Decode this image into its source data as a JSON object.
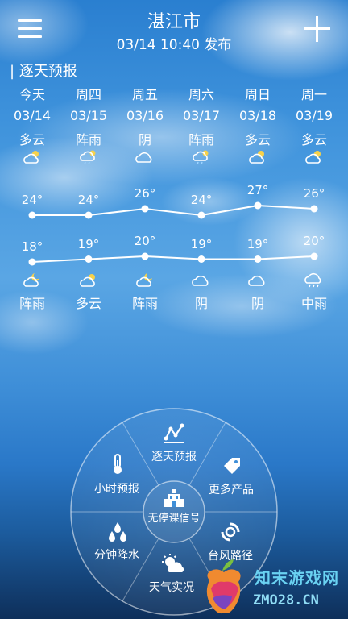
{
  "header": {
    "city": "湛江市",
    "publish_time": "03/14 10:40 发布"
  },
  "section_title": "| 逐天预报",
  "days": [
    {
      "weekday": "今天",
      "date": "03/14",
      "day_weather": "多云",
      "day_icon": "partly-cloudy-icon",
      "high": "24°",
      "low": "18°",
      "night_icon": "partly-cloudy-night-icon",
      "night_weather": "阵雨"
    },
    {
      "weekday": "周四",
      "date": "03/15",
      "day_weather": "阵雨",
      "day_icon": "shower-icon",
      "high": "24°",
      "low": "19°",
      "night_icon": "partly-cloudy-icon",
      "night_weather": "多云"
    },
    {
      "weekday": "周五",
      "date": "03/16",
      "day_weather": "阴",
      "day_icon": "overcast-icon",
      "high": "26°",
      "low": "20°",
      "night_icon": "partly-cloudy-night-icon",
      "night_weather": "阵雨"
    },
    {
      "weekday": "周六",
      "date": "03/17",
      "day_weather": "阵雨",
      "day_icon": "shower-icon",
      "high": "24°",
      "low": "19°",
      "night_icon": "overcast-icon",
      "night_weather": "阴"
    },
    {
      "weekday": "周日",
      "date": "03/18",
      "day_weather": "多云",
      "day_icon": "partly-cloudy-icon",
      "high": "27°",
      "low": "19°",
      "night_icon": "overcast-icon",
      "night_weather": "阴"
    },
    {
      "weekday": "周一",
      "date": "03/19",
      "day_weather": "多云",
      "day_icon": "partly-cloudy-icon",
      "high": "26°",
      "low": "20°",
      "night_icon": "rain-icon",
      "night_weather": "中雨"
    }
  ],
  "temperature_values": {
    "high": [
      24,
      24,
      26,
      24,
      27,
      26
    ],
    "low": [
      18,
      19,
      20,
      19,
      19,
      20
    ]
  },
  "wheel_menu": {
    "daily": "逐天预报",
    "more": "更多产品",
    "typhoon": "台风路径",
    "live": "天气实况",
    "minute_rain": "分钟降水",
    "hourly": "小时预报",
    "center": "无停课信号"
  },
  "watermark": {
    "line1": "知末游戏网",
    "line2": "ZMO28.CN"
  }
}
